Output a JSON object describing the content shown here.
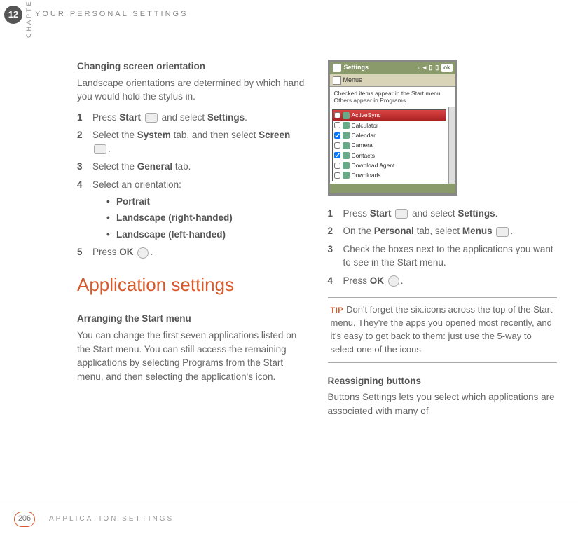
{
  "header": {
    "chapter_number": "12",
    "chapter_label": "CHAPTER",
    "running_head": "YOUR PERSONAL SETTINGS"
  },
  "left": {
    "section1_title": "Changing screen orientation",
    "section1_intro": "Landscape orientations are determined by which hand you would hold the stylus in.",
    "steps1": {
      "s1_a": "Press ",
      "s1_b": "Start",
      "s1_c": " and select ",
      "s1_d": "Settings",
      "s1_e": ".",
      "s2_a": "Select the ",
      "s2_b": "System",
      "s2_c": " tab, and then select ",
      "s2_d": "Screen",
      "s2_e": ".",
      "s3_a": "Select the ",
      "s3_b": "General",
      "s3_c": " tab.",
      "s4": "Select an orientation:",
      "b1": "Portrait",
      "b2": "Landscape (right-handed)",
      "b3": "Landscape (left-handed)",
      "s5_a": "Press ",
      "s5_b": "OK",
      "s5_c": "."
    },
    "main_heading": "Application settings",
    "section2_title": "Arranging the Start menu",
    "section2_body": "You can change the first seven applications listed on the Start menu. You can still access the remaining applications by selecting Programs from the Start menu, and then selecting the application's icon."
  },
  "right": {
    "screenshot": {
      "title": "Settings",
      "ok": "ok",
      "sub": "Menus",
      "desc": "Checked items appear in the Start menu. Others appear in Programs.",
      "rows": [
        "ActiveSync",
        "Calculator",
        "Calendar",
        "Camera",
        "Contacts",
        "Download Agent",
        "Downloads"
      ],
      "checked": [
        false,
        false,
        true,
        false,
        true,
        false,
        false
      ]
    },
    "steps": {
      "s1_a": "Press ",
      "s1_b": "Start",
      "s1_c": " and select ",
      "s1_d": "Settings",
      "s1_e": ".",
      "s2_a": "On the ",
      "s2_b": "Personal",
      "s2_c": " tab, select ",
      "s2_d": "Menus",
      "s2_e": ".",
      "s3": "Check the boxes next to the applications you want to see in the Start menu.",
      "s4_a": "Press ",
      "s4_b": "OK",
      "s4_c": "."
    },
    "tip_label": "TIP",
    "tip_text": "Don't forget the six.icons across the top of the Start menu. They're the apps you opened most recently, and it's easy to get back to them: just use the 5-way to select one of the icons",
    "section3_title": "Reassigning buttons",
    "section3_body": "Buttons Settings lets you select which applications are associated with many of"
  },
  "footer": {
    "page": "206",
    "title": "APPLICATION SETTINGS"
  }
}
